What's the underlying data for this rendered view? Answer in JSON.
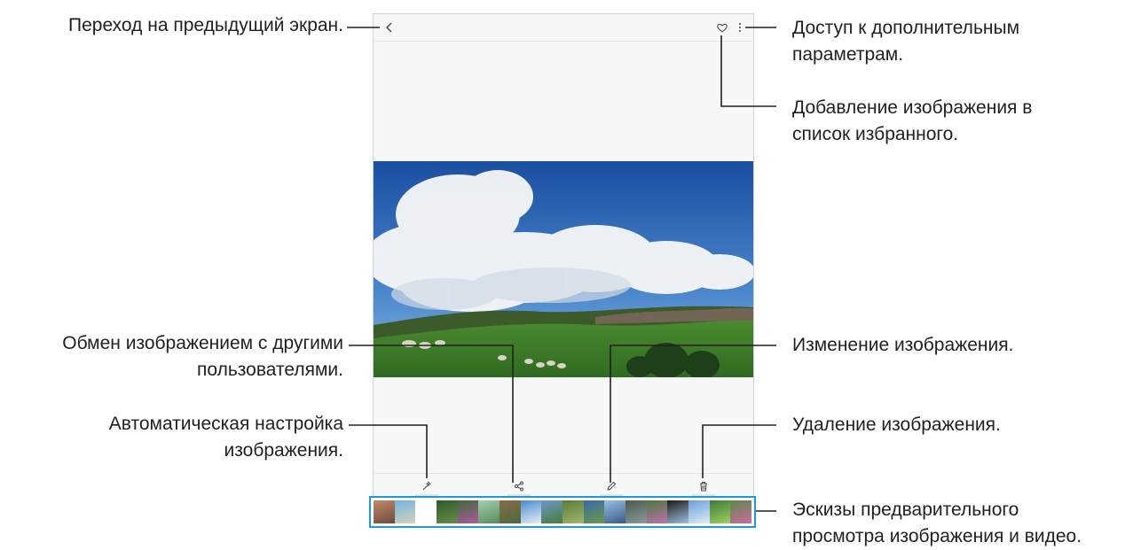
{
  "callouts": {
    "back": "Переход на предыдущий экран.",
    "more_options": [
      "Доступ к дополнительным",
      "параметрам."
    ],
    "favorite": [
      "Добавление изображения в",
      "список избранного."
    ],
    "share": [
      "Обмен изображением с другими",
      "пользователями."
    ],
    "edit": "Изменение изображения.",
    "auto_adjust": [
      "Автоматическая настройка",
      "изображения."
    ],
    "delete": "Удаление изображения.",
    "thumbnails": [
      "Эскизы предварительного",
      "просмотра изображения и видео."
    ]
  },
  "icons": {
    "back": "chevron-left-icon",
    "favorite": "heart-icon",
    "more": "more-vertical-icon",
    "auto_adjust": "magic-wand-icon",
    "share": "share-icon",
    "edit": "pencil-icon",
    "delete": "trash-icon"
  },
  "colors": {
    "accent_border": "#1e9ad6",
    "callout_line": "#231f20"
  },
  "thumbnails": [
    {
      "colors": [
        "#c48a6a",
        "#6a4a3a"
      ]
    },
    {
      "colors": [
        "#6fb6e0",
        "#d8d0b8"
      ]
    },
    {
      "colors": [
        "#ffffff",
        "#ffffff"
      ]
    },
    {
      "colors": [
        "#2f5a2a",
        "#6a8a4a"
      ]
    },
    {
      "colors": [
        "#3f6a3a",
        "#b05aa0"
      ]
    },
    {
      "colors": [
        "#a0d0b0",
        "#5a8a5a"
      ]
    },
    {
      "colors": [
        "#8a6a4a",
        "#4a6a3a"
      ]
    },
    {
      "colors": [
        "#4a8ad0",
        "#e8eef4"
      ]
    },
    {
      "colors": [
        "#6a9ac8",
        "#4a7a3a"
      ]
    },
    {
      "colors": [
        "#5a7a3a",
        "#a0b870"
      ]
    },
    {
      "colors": [
        "#3a6aa8",
        "#6a9a4a"
      ]
    },
    {
      "colors": [
        "#9ac0e0",
        "#3a5a8a"
      ]
    },
    {
      "colors": [
        "#4a5a4a",
        "#8a9aa0"
      ]
    },
    {
      "colors": [
        "#4a7a3a",
        "#c070b0"
      ]
    },
    {
      "colors": [
        "#1a1a1a",
        "#a0c0e0"
      ]
    },
    {
      "colors": [
        "#6aa0d8",
        "#e0ecf4"
      ]
    },
    {
      "colors": [
        "#3a7a3a",
        "#a0d060"
      ]
    },
    {
      "colors": [
        "#5a8a4a",
        "#d06aa0"
      ]
    }
  ]
}
